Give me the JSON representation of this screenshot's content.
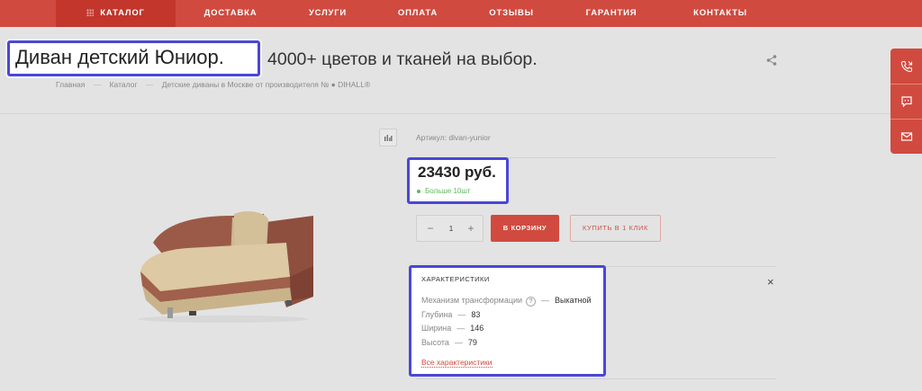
{
  "nav": {
    "items": [
      {
        "label": "КАТАЛОГ",
        "active": true
      },
      {
        "label": "ДОСТАВКА"
      },
      {
        "label": "УСЛУГИ"
      },
      {
        "label": "ОПЛАТА"
      },
      {
        "label": "ОТЗЫВЫ"
      },
      {
        "label": "ГАРАНТИЯ"
      },
      {
        "label": "КОНТАКТЫ"
      }
    ]
  },
  "product": {
    "title_highlight": "Диван детский Юниор.",
    "title_rest": "4000+ цветов и тканей на выбор.",
    "article": "Артикул: divan-yunior",
    "price": "23430 руб.",
    "stock": "Больше 10шт",
    "quantity": "1"
  },
  "breadcrumb": [
    "Главная",
    "Каталог",
    "Детские диваны в Москве от производителя № ● DIHALL®"
  ],
  "breadcrumb_sep": "—",
  "buttons": {
    "minus": "−",
    "plus": "+",
    "cart": "В КОРЗИНУ",
    "one_click": "КУПИТЬ В 1 КЛИК",
    "close": "×"
  },
  "characteristics": {
    "title": "ХАРАКТЕРИСТИКИ",
    "rows": [
      {
        "name": "Механизм трансформации",
        "value": "Выкатной",
        "help": "?"
      },
      {
        "name": "Глубина",
        "value": "83"
      },
      {
        "name": "Ширина",
        "value": "146"
      },
      {
        "name": "Высота",
        "value": "79"
      }
    ],
    "dash": "—",
    "all_link": "Все характеристики"
  },
  "icons": {
    "nav_grid": "grid-icon",
    "share": "share-icon",
    "compare": "bar-chart-icon",
    "side": [
      "phone-callback-icon",
      "chat-icon",
      "mail-icon"
    ]
  },
  "colors": {
    "brand": "#d14a3f",
    "highlight": "#4a47d6",
    "stock": "#5cb85c"
  }
}
